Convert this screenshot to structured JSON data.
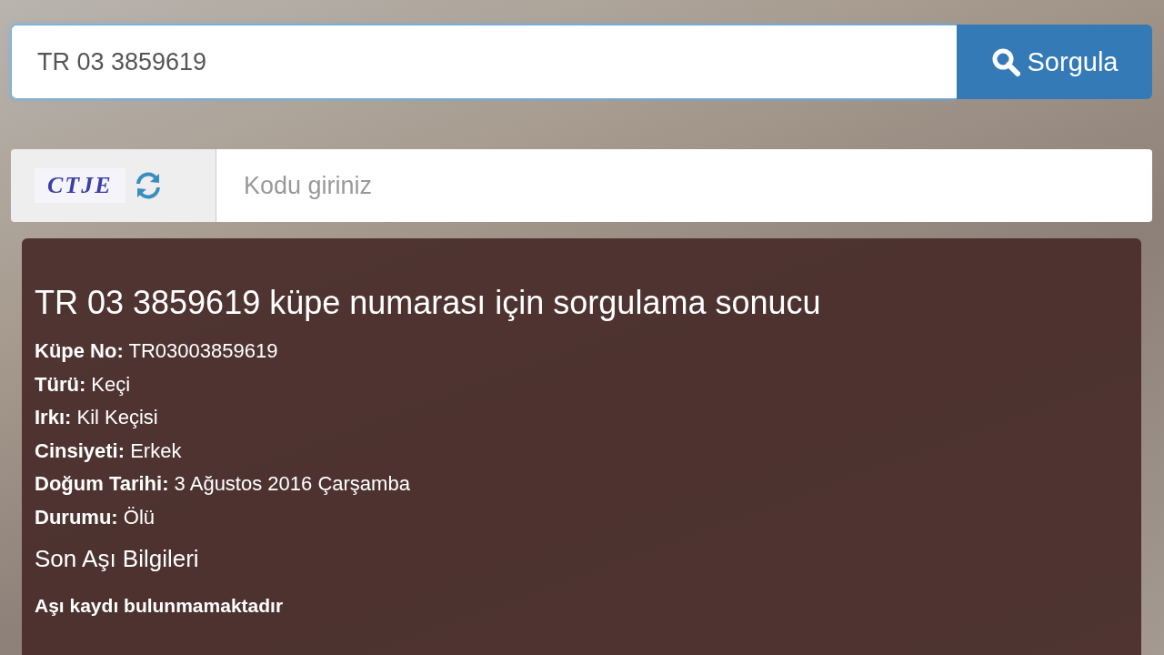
{
  "search": {
    "value": "TR 03 3859619",
    "button": "Sorgula"
  },
  "captcha": {
    "code": "CTJE",
    "placeholder": "Kodu giriniz"
  },
  "result": {
    "title": "TR 03 3859619 küpe numarası için sorgulama sonucu",
    "fields": [
      {
        "label": "Küpe No:",
        "value": "TR03003859619"
      },
      {
        "label": "Türü:",
        "value": "Keçi"
      },
      {
        "label": "Irkı:",
        "value": "Kil Keçisi"
      },
      {
        "label": "Cinsiyeti:",
        "value": "Erkek"
      },
      {
        "label": "Doğum Tarihi:",
        "value": "3 Ağustos 2016 Çarşamba"
      },
      {
        "label": "Durumu:",
        "value": "Ölü"
      }
    ],
    "section_title": "Son Aşı Bilgileri",
    "notice": "Aşı kaydı bulunmamaktadır"
  }
}
